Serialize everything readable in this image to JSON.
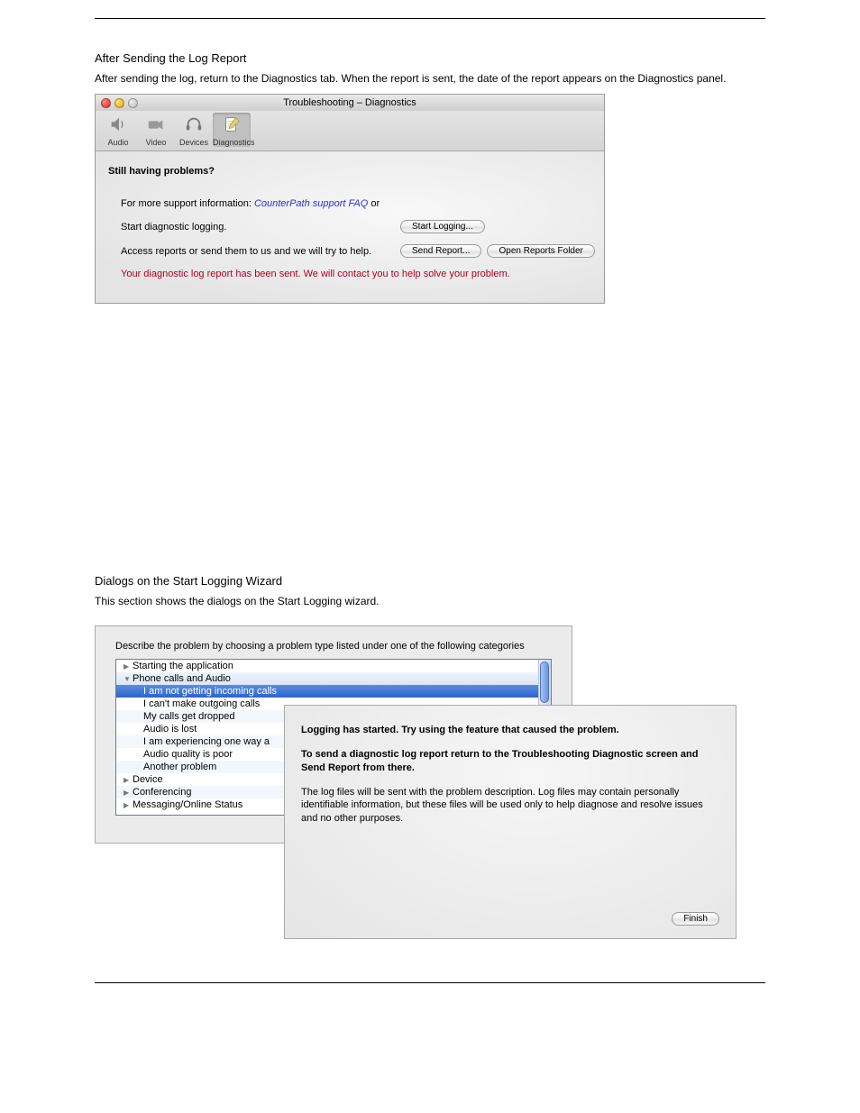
{
  "doc": {
    "heading_after": "After Sending the Log Report",
    "body_after": "After sending the log, return to the Diagnostics tab. When the report is sent, the date of the report appears on the Diagnostics panel.",
    "heading_dialogs": "Dialogs on the Start Logging Wizard",
    "body_dialogs": "This section shows the dialogs on the Start Logging wizard."
  },
  "win1": {
    "title": "Troubleshooting – Diagnostics",
    "tabs": [
      "Audio",
      "Video",
      "Devices",
      "Diagnostics"
    ],
    "heading": "Still having problems?",
    "support_prefix": "For more support information: ",
    "support_link": "CounterPath support FAQ",
    "support_suffix": "  or",
    "start_text": "Start diagnostic logging.",
    "start_btn": "Start Logging...",
    "access_text": "Access reports or send them to us and we will try to help.",
    "send_btn": "Send Report...",
    "open_btn": "Open Reports Folder",
    "confirm": "Your diagnostic log report has been sent. We will contact you to help solve your problem."
  },
  "win2": {
    "prompt": "Describe the problem by choosing a problem type listed under one of the following categories",
    "cats": {
      "c0": "Starting the application",
      "c1": "Phone calls and Audio",
      "c2": "Device",
      "c3": "Conferencing",
      "c4": "Messaging/Online Status"
    },
    "items": {
      "i0": "I am not getting incoming calls",
      "i1": "I can't make outgoing calls",
      "i2": "My calls get dropped",
      "i3": "Audio is lost",
      "i4": "I am experiencing one way a",
      "i5": "Audio quality is poor",
      "i6": "Another problem"
    }
  },
  "win3": {
    "p1": "Logging has started. Try using the feature that caused the problem.",
    "p2": "To send a diagnostic log report return to the Troubleshooting Diagnostic screen and Send Report from there.",
    "p3": "The log files will be sent with the problem description. Log files may contain personally identifiable information, but these files will be used only to help diagnose and resolve issues and no other purposes.",
    "finish": "Finish"
  }
}
